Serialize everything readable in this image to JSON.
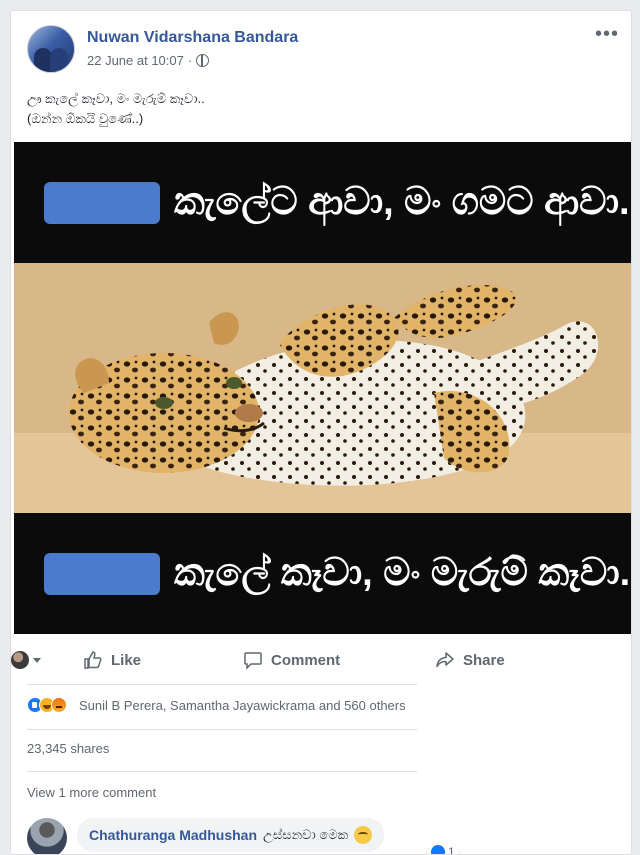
{
  "post": {
    "author": "Nuwan Vidarshana Bandara",
    "timestamp": "22 June at 10:07",
    "text_line1": "ඌ කැලේ කෑවා, මං මැරුම් කෑවා..",
    "text_line2": "(ඔන්න ඕකයි වුණේ..)"
  },
  "meme": {
    "top_text": "කැලේට ආවා, මං ගමට ආවා.",
    "bottom_text": "කැලේ කෑවා, මං මැරුම් කෑවා."
  },
  "actions": {
    "like": "Like",
    "comment": "Comment",
    "share": "Share"
  },
  "reactions": {
    "summary": "Sunil B Perera, Samantha Jayawickrama and 560 others"
  },
  "shares": "23,345 shares",
  "view_more": "View 1 more comment",
  "comment": {
    "author": "Chathuranga Madhushan",
    "text": "උස්සනවා මෙක",
    "like_count": "1"
  },
  "colors": {
    "link_blue": "#365899",
    "meme_box_blue": "#4b7bcc",
    "like_blue": "#1877f2"
  }
}
